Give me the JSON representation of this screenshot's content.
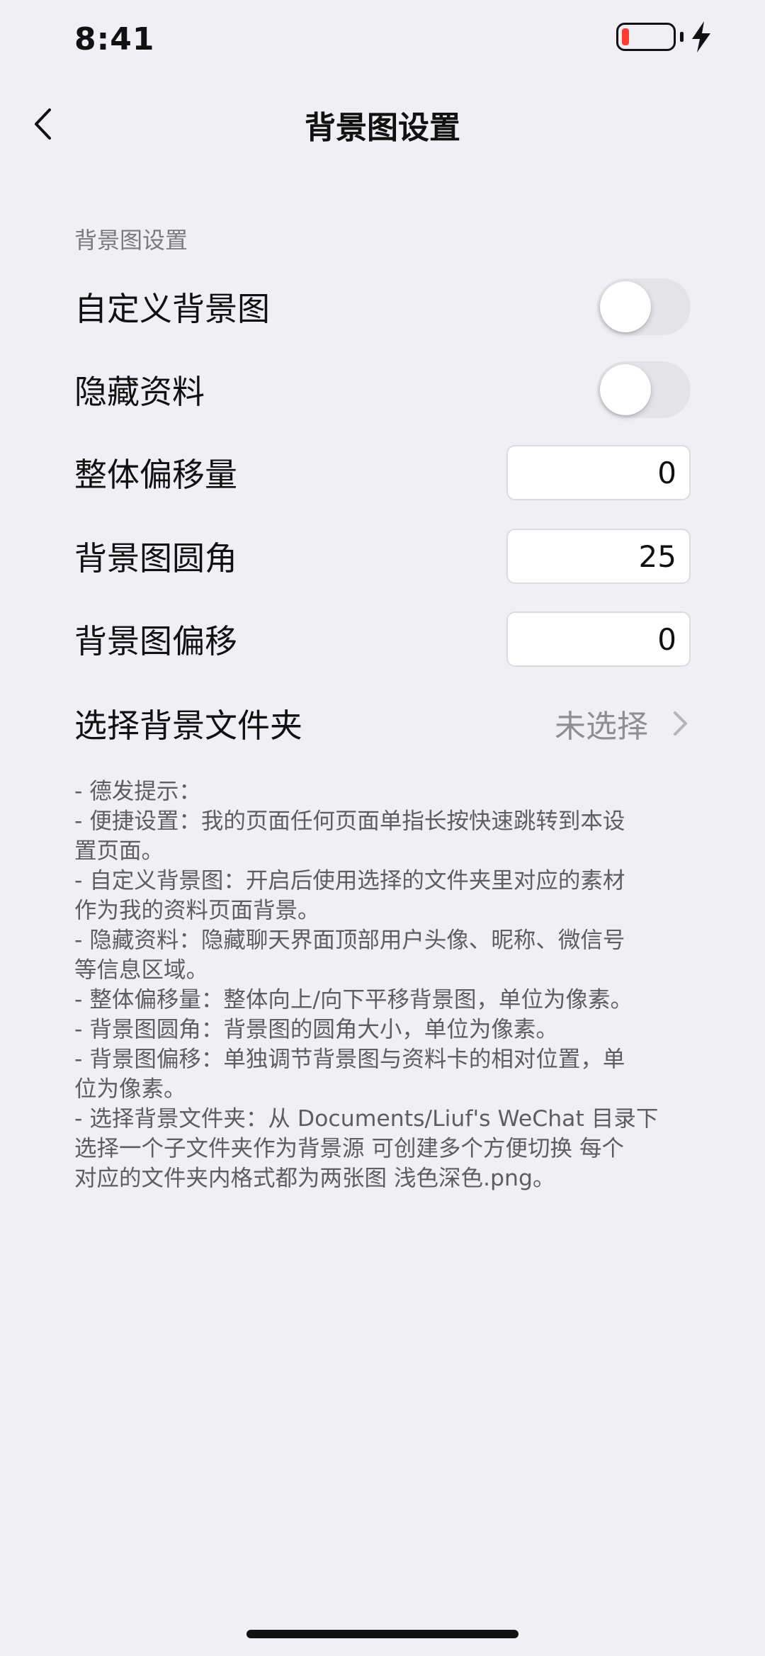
{
  "status_bar": {
    "time": "8:41",
    "battery_level_percent": 10,
    "charging": true
  },
  "nav": {
    "title": "背景图设置"
  },
  "section": {
    "header": "背景图设置"
  },
  "rows": {
    "custom_background": {
      "label": "自定义背景图",
      "enabled": false
    },
    "hide_profile": {
      "label": "隐藏资料",
      "enabled": false
    },
    "overall_offset": {
      "label": "整体偏移量",
      "value": "0"
    },
    "background_radius": {
      "label": "背景图圆角",
      "value": "25"
    },
    "background_offset": {
      "label": "背景图偏移",
      "value": "0"
    },
    "select_folder": {
      "label": "选择背景文件夹",
      "value": "未选择"
    }
  },
  "help": {
    "lines": [
      "- 德发提示：",
      "- 便捷设置：我的页面任何页面单指长按快速跳转到本设",
      "置页面。",
      "- 自定义背景图：开启后使用选择的文件夹里对应的素材",
      "作为我的资料页面背景。",
      "- 隐藏资料：隐藏聊天界面顶部用户头像、昵称、微信号",
      "等信息区域。",
      "- 整体偏移量：整体向上/向下平移背景图，单位为像素。",
      "- 背景图圆角：背景图的圆角大小，单位为像素。",
      "- 背景图偏移：单独调节背景图与资料卡的相对位置，单",
      "位为像素。",
      "- 选择背景文件夹：从 Documents/Liuf's WeChat 目录下",
      "选择一个子文件夹作为背景源 可创建多个方便切换 每个",
      "对应的文件夹内格式都为两张图 浅色深色.png。"
    ]
  },
  "colors": {
    "background": "#efeff4",
    "toggle_off": "#e3e3e8",
    "battery_low": "#ff3b30",
    "secondary_text": "#8e8e93"
  }
}
